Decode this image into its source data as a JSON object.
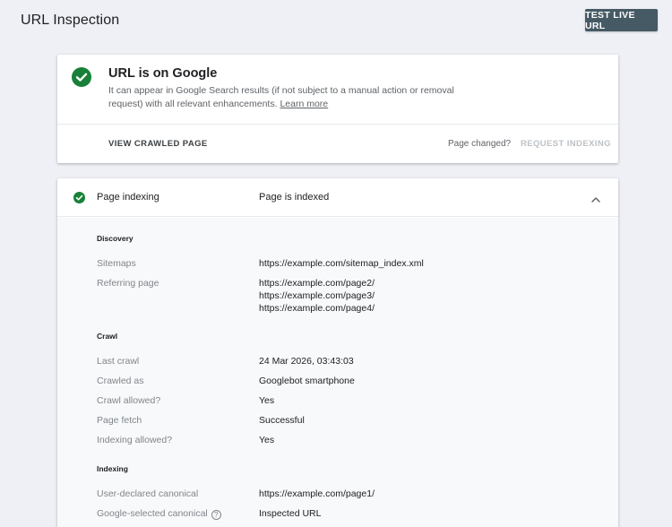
{
  "header": {
    "title": "URL Inspection",
    "test_live_url_label": "TEST LIVE URL"
  },
  "status": {
    "icon": "check-circle-icon",
    "title": "URL is on Google",
    "description": "It can appear in Google Search results (if not subject to a manual action or removal request) with all relevant enhancements.",
    "learn_more_label": "Learn more",
    "view_crawled_label": "VIEW CRAWLED PAGE",
    "page_changed_label": "Page changed?",
    "request_indexing_label": "REQUEST INDEXING"
  },
  "page_indexing": {
    "label": "Page indexing",
    "value": "Page is indexed",
    "sections": {
      "discovery": {
        "heading": "Discovery",
        "sitemaps_label": "Sitemaps",
        "sitemaps_value": "https://example.com/sitemap_index.xml",
        "referring_label": "Referring page",
        "referring_pages": [
          "https://example.com/page2/",
          "https://example.com/page3/",
          "https://example.com/page4/"
        ]
      },
      "crawl": {
        "heading": "Crawl",
        "last_crawl_label": "Last crawl",
        "last_crawl_value": "24 Mar 2026, 03:43:03",
        "crawled_as_label": "Crawled as",
        "crawled_as_value": "Googlebot smartphone",
        "crawl_allowed_label": "Crawl allowed?",
        "crawl_allowed_value": "Yes",
        "page_fetch_label": "Page fetch",
        "page_fetch_value": "Successful",
        "indexing_allowed_label": "Indexing allowed?",
        "indexing_allowed_value": "Yes"
      },
      "indexing": {
        "heading": "Indexing",
        "user_canonical_label": "User-declared canonical",
        "user_canonical_value": "https://example.com/page1/",
        "google_canonical_label": "Google-selected canonical",
        "google_canonical_value": "Inspected URL"
      }
    }
  },
  "colors": {
    "success_green": "#188038",
    "button_dark": "#455a64",
    "background": "#eef0f5"
  }
}
